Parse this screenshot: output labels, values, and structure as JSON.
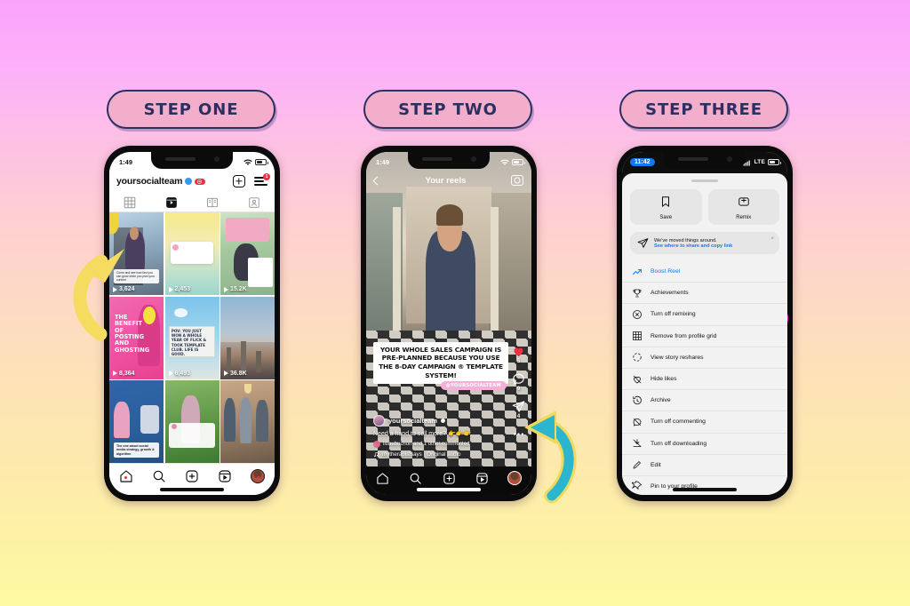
{
  "steps": [
    {
      "label": "STEP ONE"
    },
    {
      "label": "STEP TWO"
    },
    {
      "label": "STEP THREE"
    }
  ],
  "colors": {
    "bg_top": "#fba3fb",
    "bg_bottom": "#fdf9a2",
    "pill_fill": "#f3aecb",
    "pill_border": "#2b2f62",
    "arrow_yellow": "#f5dc60",
    "arrow_teal": "#2bb5ce",
    "arrow_magenta": "#f414d6",
    "ig_blue": "#1479f0",
    "ig_red": "#ed2f44"
  },
  "phone1": {
    "status": {
      "time": "1:49",
      "wifi": "wifi-icon",
      "battery": "battery-icon"
    },
    "header": {
      "username": "yoursocialteam",
      "verified_icon": "verified-badge-icon",
      "pro_badge": "PRO",
      "add_icon": "plus-square-icon",
      "menu_icon": "hamburger-menu-icon",
      "menu_badge": "1"
    },
    "tabs": [
      {
        "name": "grid-tab",
        "icon": "grid-icon",
        "selected": false
      },
      {
        "name": "reels-tab",
        "icon": "reels-icon",
        "selected": true
      },
      {
        "name": "guides-tab",
        "icon": "guides-icon",
        "selected": false
      },
      {
        "name": "tagged-tab",
        "icon": "tagged-person-icon",
        "selected": false
      }
    ],
    "grid": [
      {
        "views": "3,624",
        "caption": "Come and see how fast you can grow when you plan your content",
        "overlay": ""
      },
      {
        "views": "2,453",
        "caption": "",
        "overlay": ""
      },
      {
        "views": "15.2K",
        "caption": "",
        "overlay": ""
      },
      {
        "views": "8,364",
        "caption": "",
        "overlay": "THE BENEFIT OF POSTING AND GHOSTING"
      },
      {
        "views": "6,493",
        "caption": "",
        "overlay": "POV: YOU JUST WON A WHOLE YEAR OF FLICK & TOOK TEMPLATE CLUB. LIFE IS GOOD."
      },
      {
        "views": "36.8K",
        "caption": "",
        "overlay": ""
      },
      {
        "views": "",
        "caption": "The one about social media strategy, growth & algorithm",
        "overlay": ""
      },
      {
        "views": "",
        "caption": "",
        "overlay": ""
      },
      {
        "views": "",
        "caption": "",
        "overlay": ""
      }
    ],
    "nav": [
      {
        "name": "home-icon"
      },
      {
        "name": "search-icon"
      },
      {
        "name": "create-icon"
      },
      {
        "name": "reels-icon"
      },
      {
        "name": "profile-avatar"
      }
    ]
  },
  "phone2": {
    "status": {
      "time": "1:49"
    },
    "header": {
      "back_icon": "chevron-left-icon",
      "title": "Your reels",
      "camera_icon": "camera-icon"
    },
    "caption_overlay": "YOUR WHOLE SALES CAMPAIGN IS PRE-PLANNED BECAUSE YOU USE THE 8-DAY CAMPAIGN ® TEMPLATE SYSTEM!",
    "handle_tag": "@YOURSOCIALTEAM",
    "meta": {
      "username": "yoursocialteam",
      "caption": "Need a hand to sell more? 👉👉👉",
      "comment_note": "libaubuchon and 1 other commented",
      "audio": "mytherapistsays · Original audio"
    },
    "rail": [
      {
        "name": "like-heart-icon",
        "count": "5"
      },
      {
        "name": "comment-bubble-icon",
        "count": "9"
      },
      {
        "name": "share-paperplane-icon",
        "count": "4"
      },
      {
        "name": "more-options-icon",
        "count": ""
      }
    ],
    "nav": [
      {
        "name": "home-icon"
      },
      {
        "name": "search-icon"
      },
      {
        "name": "create-icon"
      },
      {
        "name": "reels-icon"
      },
      {
        "name": "profile-avatar"
      }
    ]
  },
  "phone3": {
    "status": {
      "time": "11:42",
      "network": "LTE"
    },
    "buttons": [
      {
        "label": "Save",
        "icon": "bookmark-icon"
      },
      {
        "label": "Remix",
        "icon": "remix-icon"
      }
    ],
    "banner": {
      "icon": "paperplane-icon",
      "line1": "We've moved things around.",
      "line2": "See where to share and copy link",
      "close": "×"
    },
    "menu": [
      {
        "label": "Boost Reel",
        "icon": "trending-up-icon",
        "highlight": true
      },
      {
        "label": "Achievements",
        "icon": "trophy-icon",
        "highlight": false
      },
      {
        "label": "Turn off remixing",
        "icon": "no-remix-icon",
        "highlight": false
      },
      {
        "label": "Remove from profile grid",
        "icon": "grid-icon",
        "highlight": false
      },
      {
        "label": "View story reshares",
        "icon": "story-circle-icon",
        "highlight": false
      },
      {
        "label": "Hide likes",
        "icon": "hidden-heart-icon",
        "highlight": false
      },
      {
        "label": "Archive",
        "icon": "clock-rewind-icon",
        "highlight": false
      },
      {
        "label": "Turn off commenting",
        "icon": "no-comment-icon",
        "highlight": false
      },
      {
        "label": "Turn off downloading",
        "icon": "no-download-icon",
        "highlight": false
      },
      {
        "label": "Edit",
        "icon": "pencil-icon",
        "highlight": false
      },
      {
        "label": "Pin to your profile",
        "icon": "pin-icon",
        "highlight": false
      }
    ]
  },
  "annotations": [
    {
      "name": "yellow-arrow-to-reel",
      "color": "#f5dc60"
    },
    {
      "name": "teal-arrow-to-more-options",
      "color": "#2bb5ce"
    },
    {
      "name": "teal-magenta-arrow-to-turn-off-downloading",
      "color": "#2bb5ce"
    }
  ]
}
